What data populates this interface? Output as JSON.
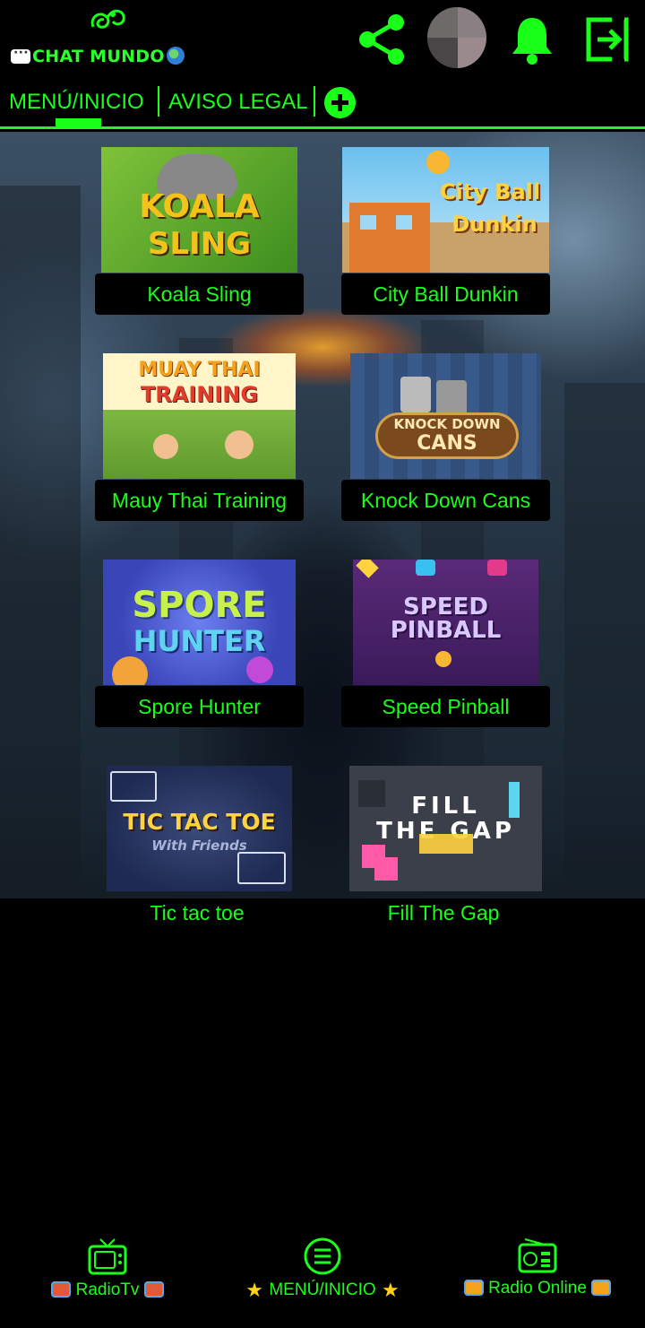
{
  "header": {
    "brand": "CHAT MUNDO",
    "icons": [
      "share-icon",
      "avatar",
      "bell-icon",
      "exit-icon"
    ]
  },
  "tabs": {
    "items": [
      {
        "label": "MENÚ/INICIO",
        "active": true
      },
      {
        "label": "AVISO LEGAL",
        "active": false
      }
    ],
    "add_icon": "plus-circle-icon"
  },
  "games": [
    {
      "title": "Koala Sling",
      "art": [
        "KOALA",
        "SLING"
      ]
    },
    {
      "title": "City Ball Dunkin",
      "art": [
        "City Ball",
        "Dunkin"
      ]
    },
    {
      "title": "Mauy Thai Training",
      "art": [
        "MUAY THAI",
        "TRAINING"
      ]
    },
    {
      "title": "Knock Down Cans",
      "art": [
        "KNOCK DOWN",
        "CANS"
      ]
    },
    {
      "title": "Spore Hunter",
      "art": [
        "SPORE",
        "HUNTER"
      ]
    },
    {
      "title": "Speed Pinball",
      "art": [
        "SPEED",
        "PINBALL"
      ]
    },
    {
      "title": "Tic tac toe",
      "art": [
        "TIC TAC TOE",
        "With Friends"
      ]
    },
    {
      "title": "Fill The Gap",
      "art": [
        "FILL",
        "THE GAP"
      ]
    }
  ],
  "bottom_nav": [
    {
      "label": "RadioTv",
      "icon": "tv-icon"
    },
    {
      "label": "MENÚ/INICIO",
      "icon": "menu-icon"
    },
    {
      "label": "Radio Online",
      "icon": "radio-icon"
    }
  ],
  "colors": {
    "accent": "#1aff1a",
    "background": "#000000"
  }
}
